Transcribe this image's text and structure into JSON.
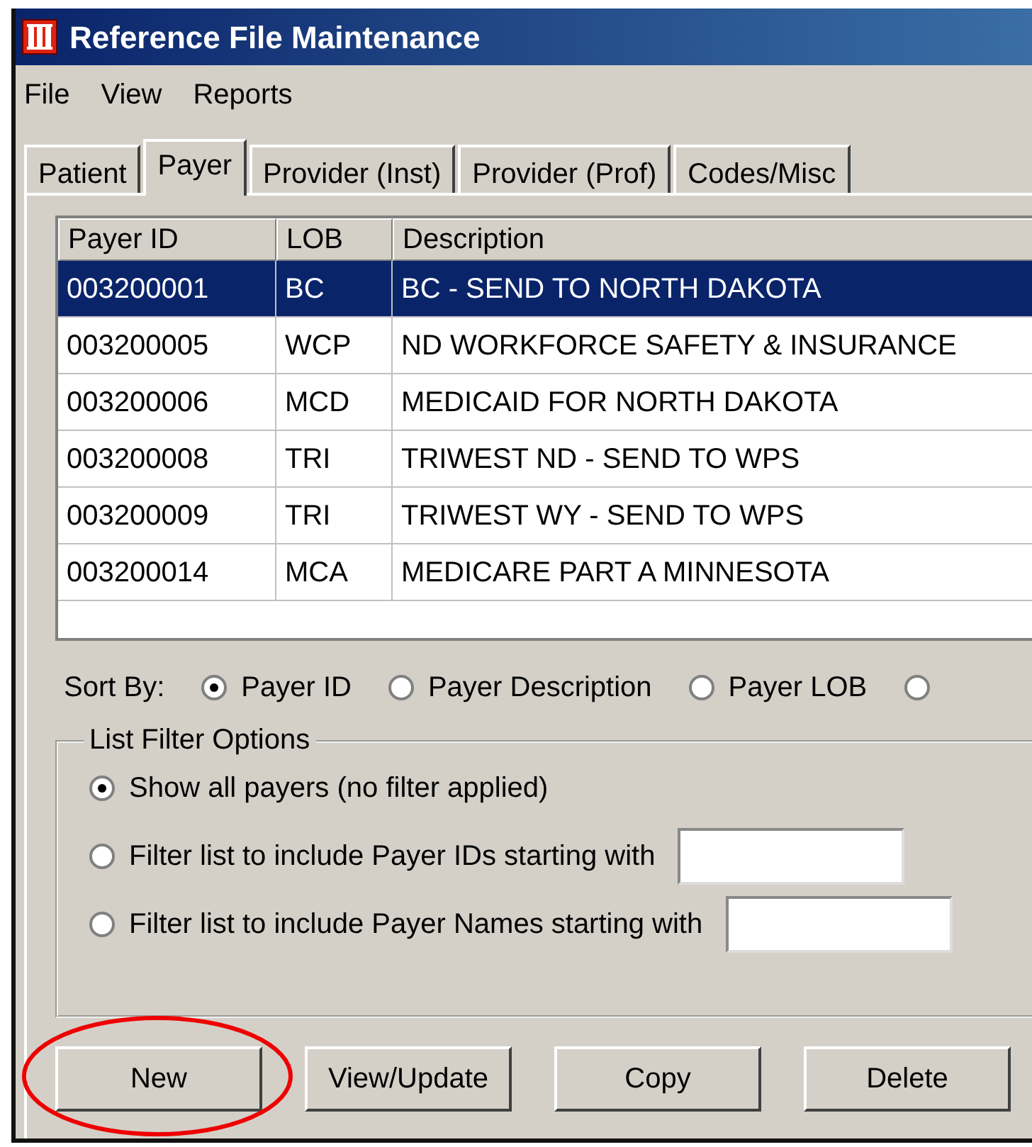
{
  "window": {
    "title": "Reference File Maintenance"
  },
  "menu": [
    "File",
    "View",
    "Reports"
  ],
  "tabs": [
    {
      "label": "Patient",
      "selected": false
    },
    {
      "label": "Payer",
      "selected": true
    },
    {
      "label": "Provider (Inst)",
      "selected": false
    },
    {
      "label": "Provider (Prof)",
      "selected": false
    },
    {
      "label": "Codes/Misc",
      "selected": false
    }
  ],
  "table": {
    "columns": [
      "Payer ID",
      "LOB",
      "Description"
    ],
    "rows": [
      {
        "cells": [
          "003200001",
          "BC",
          "BC - SEND TO NORTH DAKOTA"
        ],
        "selected": true
      },
      {
        "cells": [
          "003200005",
          "WCP",
          "ND WORKFORCE SAFETY & INSURANCE"
        ],
        "selected": false
      },
      {
        "cells": [
          "003200006",
          "MCD",
          "MEDICAID FOR NORTH DAKOTA"
        ],
        "selected": false
      },
      {
        "cells": [
          "003200008",
          "TRI",
          "TRIWEST ND - SEND TO WPS"
        ],
        "selected": false
      },
      {
        "cells": [
          "003200009",
          "TRI",
          "TRIWEST WY - SEND TO WPS"
        ],
        "selected": false
      },
      {
        "cells": [
          "003200014",
          "MCA",
          "MEDICARE PART A MINNESOTA"
        ],
        "selected": false
      }
    ]
  },
  "sort_by": {
    "label": "Sort By:",
    "options": [
      {
        "label": "Payer ID",
        "selected": true
      },
      {
        "label": "Payer Description",
        "selected": false
      },
      {
        "label": "Payer LOB",
        "selected": false
      },
      {
        "selected": false
      }
    ]
  },
  "filter": {
    "title": "List Filter Options",
    "options": [
      {
        "label": "Show all payers (no filter applied)",
        "selected": true,
        "has_field": false
      },
      {
        "label": "Filter list to include Payer IDs starting with",
        "selected": false,
        "has_field": true
      },
      {
        "label": "Filter list to include Payer Names starting with",
        "selected": false,
        "has_field": true
      }
    ]
  },
  "buttons": [
    {
      "label": "New",
      "annotation": {
        "kind": "ellipse",
        "color": "#ee0000"
      }
    },
    {
      "label": "View/Update"
    },
    {
      "label": "Copy"
    },
    {
      "label": "Delete"
    }
  ]
}
